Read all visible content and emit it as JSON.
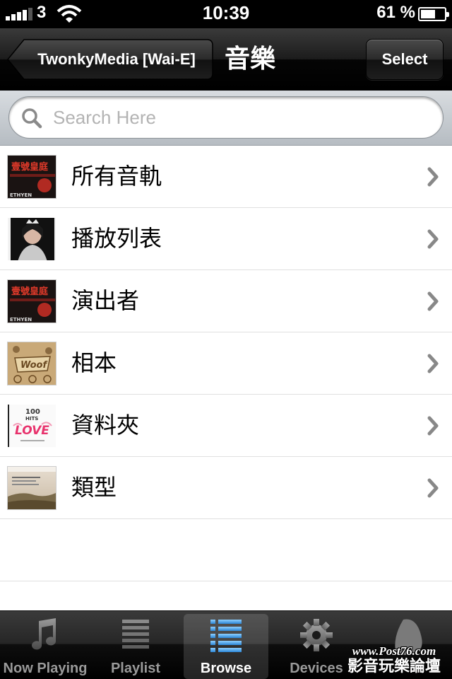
{
  "status_bar": {
    "carrier": "3",
    "time": "10:39",
    "battery_percent": "61 %",
    "battery_level": 0.61,
    "signal_bars": 4
  },
  "nav_bar": {
    "back_label": "TwonkyMedia [Wai-E]",
    "title": "音樂",
    "select_label": "Select"
  },
  "search": {
    "placeholder": "Search Here",
    "value": ""
  },
  "list": {
    "items": [
      {
        "label": "所有音軌",
        "art_icon": "album-art-red",
        "cover_text": "壹號皇庭"
      },
      {
        "label": "播放列表",
        "art_icon": "album-art-portrait"
      },
      {
        "label": "演出者",
        "art_icon": "album-art-red",
        "cover_text": "壹號皇庭"
      },
      {
        "label": "相本",
        "art_icon": "album-art-woof",
        "cover_text": "Woof"
      },
      {
        "label": "資料夾",
        "art_icon": "album-art-love",
        "cover_text": "LOVE"
      },
      {
        "label": "類型",
        "art_icon": "album-art-landscape"
      }
    ]
  },
  "tab_bar": {
    "tabs": [
      {
        "label": "Now Playing",
        "icon": "music-note-icon",
        "active": false
      },
      {
        "label": "Playlist",
        "icon": "list-lines-icon",
        "active": false
      },
      {
        "label": "Browse",
        "icon": "browse-list-icon",
        "active": true
      },
      {
        "label": "Devices",
        "icon": "gear-icon",
        "active": false
      },
      {
        "label": "",
        "icon": "more-icon",
        "active": false
      }
    ]
  },
  "watermark": {
    "line1": "www.Post76.com",
    "line2": "影音玩樂論壇"
  },
  "colors": {
    "nav_bar": "#1c1c1c",
    "active_tab_icon": "#3fa2ea",
    "chevron": "#888888"
  }
}
